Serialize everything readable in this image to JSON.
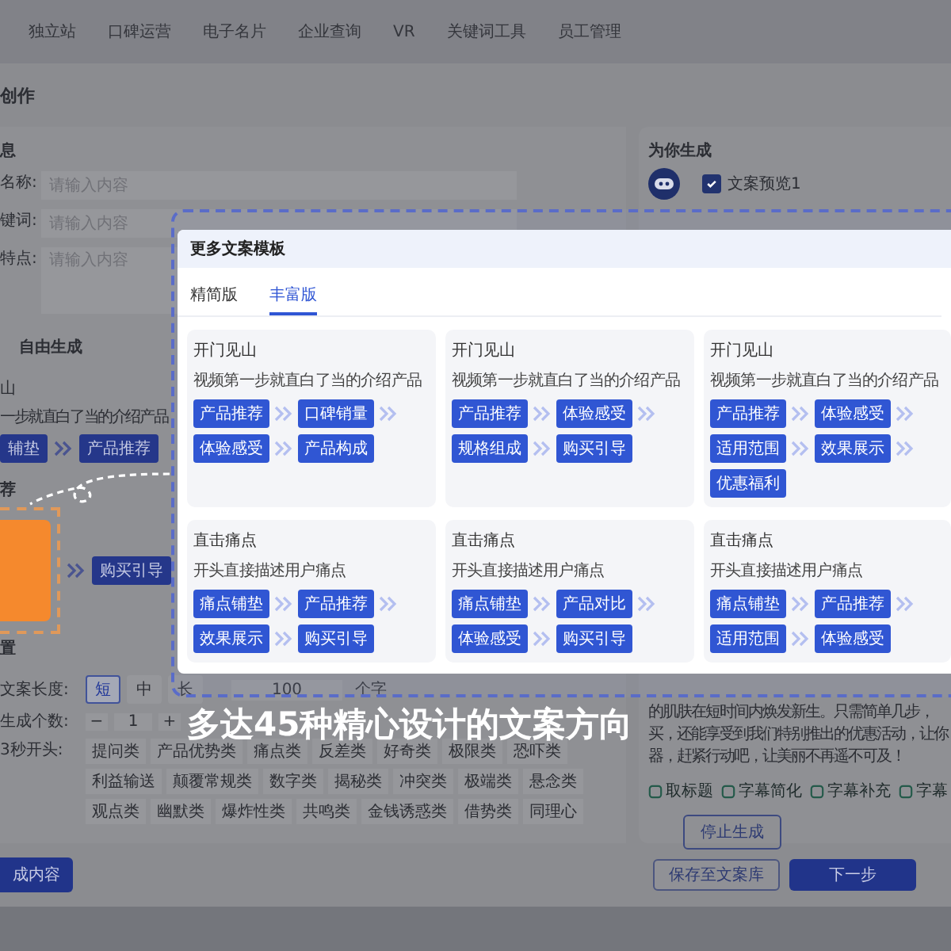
{
  "nav": {
    "items": [
      {
        "label": "独立站",
        "selected": false
      },
      {
        "label": "口碑运营",
        "selected": false
      },
      {
        "label": "电子名片",
        "selected": false
      },
      {
        "label": "企业查询",
        "selected": false
      },
      {
        "label": "VR",
        "selected": false
      },
      {
        "label": "关键词工具",
        "selected": false
      },
      {
        "label": "员工管理",
        "selected": false
      }
    ]
  },
  "page_title": "创作",
  "form": {
    "section_title": "息",
    "fields": [
      {
        "label": "名称:",
        "placeholder": "请输入内容",
        "kind": "input"
      },
      {
        "label": "键词:",
        "placeholder": "请输入内容",
        "kind": "input"
      },
      {
        "label": "特点:",
        "placeholder": "请输入内容",
        "kind": "textarea"
      }
    ],
    "mode_tab": "自由生成",
    "preview": {
      "title": "山",
      "description": "一步就直白了当的介绍产品",
      "steps": [
        "辅垫",
        "产品推荐"
      ],
      "section_label": "荐",
      "after_highlight_step": "购买引导"
    },
    "settings_title": "置",
    "length": {
      "label": "文案长度:",
      "options": [
        {
          "label": "短",
          "selected": true
        },
        {
          "label": "中",
          "selected": false
        },
        {
          "label": "长",
          "selected": false
        }
      ],
      "value": "100",
      "unit": "个字"
    },
    "count": {
      "label": "生成个数:",
      "minus": "−",
      "value": "1",
      "plus": "+"
    },
    "openings": {
      "label": "3秒开头:",
      "tags": [
        "提问类",
        "产品优势类",
        "痛点类",
        "反差类",
        "好奇类",
        "极限类",
        "恐吓类",
        "利益输送",
        "颠覆常规类",
        "数字类",
        "揭秘类",
        "冲突类",
        "极端类",
        "悬念类",
        "观点类",
        "幽默类",
        "爆炸性类",
        "共鸣类",
        "金钱诱惑类",
        "借势类",
        "同理心"
      ]
    },
    "generate_button": "成内容"
  },
  "result": {
    "title": "为你生成",
    "preview_checkbox": {
      "label": "文案预览1",
      "checked": true
    },
    "lines": [
      "的肌肤在短时间内焕发新生。只需简单几步，",
      "买，还能享受到我们特别推出的优惠活动，让你",
      "器，赶紧行动吧，让美丽不再遥不可及！"
    ],
    "actions": [
      "取标题",
      "字幕简化",
      "字幕补充",
      "字幕"
    ],
    "stop_button": "停止生成"
  },
  "footer": {
    "save_button": "保存至文案库",
    "next_button": "下一步"
  },
  "modal": {
    "title": "更多文案模板",
    "tabs": [
      {
        "label": "精简版",
        "selected": false
      },
      {
        "label": "丰富版",
        "selected": true
      }
    ],
    "cards": [
      {
        "title": "开门见山",
        "description": "视频第一步就直白了当的介绍产品",
        "steps": [
          "产品推荐",
          "口碑销量",
          "体验感受",
          "产品构成"
        ]
      },
      {
        "title": "开门见山",
        "description": "视频第一步就直白了当的介绍产品",
        "steps": [
          "产品推荐",
          "体验感受",
          "规格组成",
          "购买引导"
        ]
      },
      {
        "title": "开门见山",
        "description": "视频第一步就直白了当的介绍产品",
        "steps": [
          "产品推荐",
          "体验感受",
          "适用范围",
          "效果展示",
          "优惠福利"
        ]
      },
      {
        "title": "直击痛点",
        "description": "开头直接描述用户痛点",
        "steps": [
          "痛点铺垫",
          "产品推荐",
          "效果展示",
          "购买引导"
        ]
      },
      {
        "title": "直击痛点",
        "description": "开头直接描述用户痛点",
        "steps": [
          "痛点铺垫",
          "产品对比",
          "体验感受",
          "购买引导"
        ]
      },
      {
        "title": "直击痛点",
        "description": "开头直接描述用户痛点",
        "steps": [
          "痛点铺垫",
          "产品推荐",
          "适用范围",
          "体验感受"
        ]
      }
    ]
  },
  "caption": "多达45种精心设计的文案方向"
}
